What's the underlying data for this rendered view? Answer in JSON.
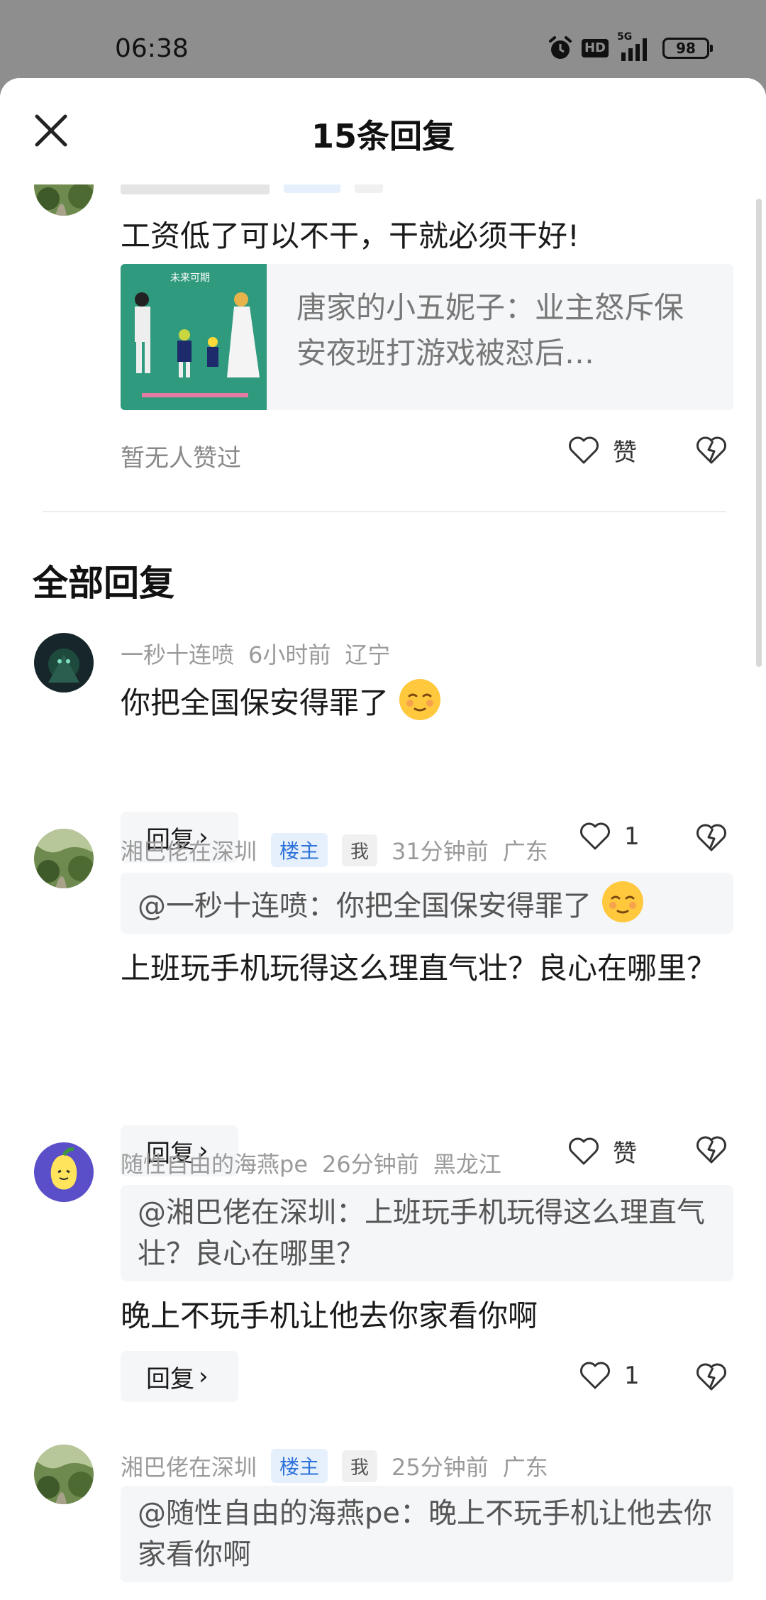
{
  "status_bar": {
    "time": "06:38",
    "hd": "HD",
    "network": "5G",
    "battery": "98",
    "icons": [
      "alarm-icon",
      "hd-icon",
      "signal-icon",
      "battery-icon"
    ]
  },
  "header": {
    "title": "15条回复",
    "close_icon": "close-icon"
  },
  "top_comment": {
    "text": "工资低了可以不干，干就必须干好!",
    "link_card": {
      "title": "唐家的小五妮子：业主怒斥保安夜班打游戏被怼后…",
      "thumb_caption": "未来可期"
    },
    "no_likes": "暂无人赞过",
    "like_label": "赞"
  },
  "section_title": "全部回复",
  "replies": [
    {
      "user": "一秒十连喷",
      "time": "6小时前",
      "location": "辽宁",
      "text": "你把全国保安得罪了",
      "reply_label": "回复",
      "like_count": "1"
    },
    {
      "user": "湘巴佬在深圳",
      "tag_owner": "楼主",
      "tag_me": "我",
      "time": "31分钟前",
      "location": "广东",
      "quote": "@一秒十连喷：你把全国保安得罪了",
      "text": "上班玩手机玩得这么理直气壮？良心在哪里？",
      "reply_label": "回复",
      "like_label": "赞"
    },
    {
      "user": "随性自由的海燕pe",
      "time": "26分钟前",
      "location": "黑龙江",
      "quote": "@湘巴佬在深圳：上班玩手机玩得这么理直气壮？良心在哪里？",
      "text": "晚上不玩手机让他去你家看你啊",
      "reply_label": "回复",
      "like_count": "1"
    },
    {
      "user": "湘巴佬在深圳",
      "tag_owner": "楼主",
      "tag_me": "我",
      "time": "25分钟前",
      "location": "广东",
      "quote": "@随性自由的海燕pe：晚上不玩手机让他去你家看你啊"
    }
  ],
  "colors": {
    "owner_tag": "#2e73d9",
    "meta_text": "#9a9a9a",
    "card_bg": "#f5f6f8"
  }
}
